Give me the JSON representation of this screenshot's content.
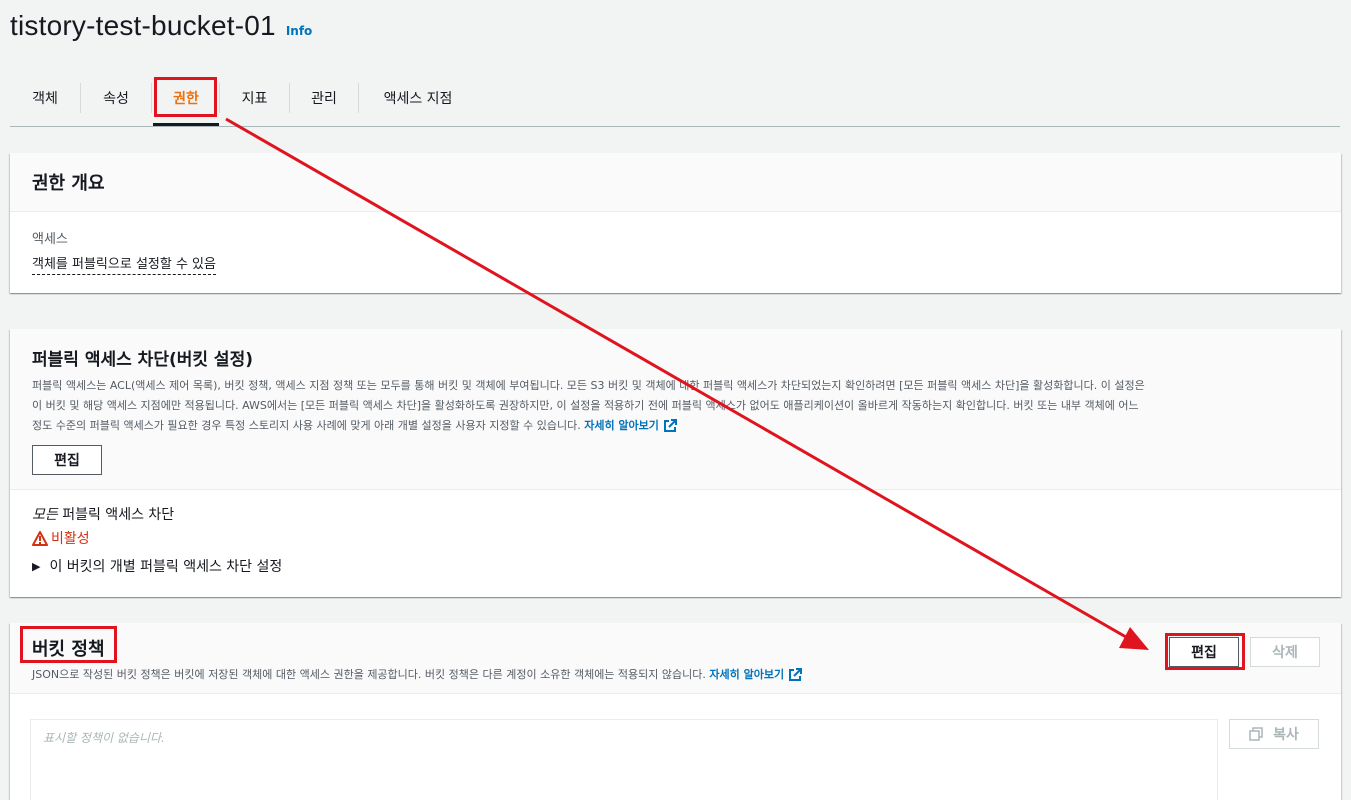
{
  "header": {
    "title": "tistory-test-bucket-01",
    "info": "Info"
  },
  "tabs": [
    {
      "label": "객체"
    },
    {
      "label": "속성"
    },
    {
      "label": "권한",
      "active": true
    },
    {
      "label": "지표"
    },
    {
      "label": "관리"
    },
    {
      "label": "액세스 지점"
    }
  ],
  "overview": {
    "title": "권한 개요",
    "access_label": "액세스",
    "access_value": "객체를 퍼블릭으로 설정할 수 있음"
  },
  "block_public": {
    "title": "퍼블릭 액세스 차단(버킷 설정)",
    "description_line1": "퍼블릭 액세스는 ACL(액세스 제어 목록), 버킷 정책, 액세스 지점 정책 또는 모두를 통해 버킷 및 객체에 부여됩니다. 모든 S3 버킷 및 객체에 대한 퍼블릭 액세스가 차단되었는지 확인하려면 [모든 퍼블릭 액세스 차단]을 활성화합니다. 이 설정은",
    "description_line2": "이 버킷 및 해당 액세스 지점에만 적용됩니다. AWS에서는 [모든 퍼블릭 액세스 차단]을 활성화하도록 권장하지만, 이 설정을 적용하기 전에 퍼블릭 액세스가 없어도 애플리케이션이 올바르게 작동하는지 확인합니다. 버킷 또는 내부 객체에 어느",
    "description_line3": "정도 수준의 퍼블릭 액세스가 필요한 경우 특정 스토리지 사용 사례에 맞게 아래 개별 설정을 사용자 지정할 수 있습니다.",
    "learn_more": "자세히 알아보기",
    "edit_label": "편집",
    "all_block_prefix": "모든",
    "all_block_label": "퍼블릭 액세스 차단",
    "status": "비활성",
    "expand_label": "이 버킷의 개별 퍼블릭 액세스 차단 설정"
  },
  "bucket_policy": {
    "title": "버킷 정책",
    "description": "JSON으로 작성된 버킷 정책은 버킷에 저장된 객체에 대한 액세스 권한을 제공합니다. 버킷 정책은 다른 계정이 소유한 객체에는 적용되지 않습니다.",
    "learn_more": "자세히 알아보기",
    "edit_label": "편집",
    "delete_label": "삭제",
    "placeholder": "표시할 정책이 없습니다.",
    "copy_label": "복사"
  },
  "colors": {
    "accent": "#ec7211",
    "link": "#0073bb",
    "warning": "#d13212",
    "annotation": "#e0141e"
  }
}
